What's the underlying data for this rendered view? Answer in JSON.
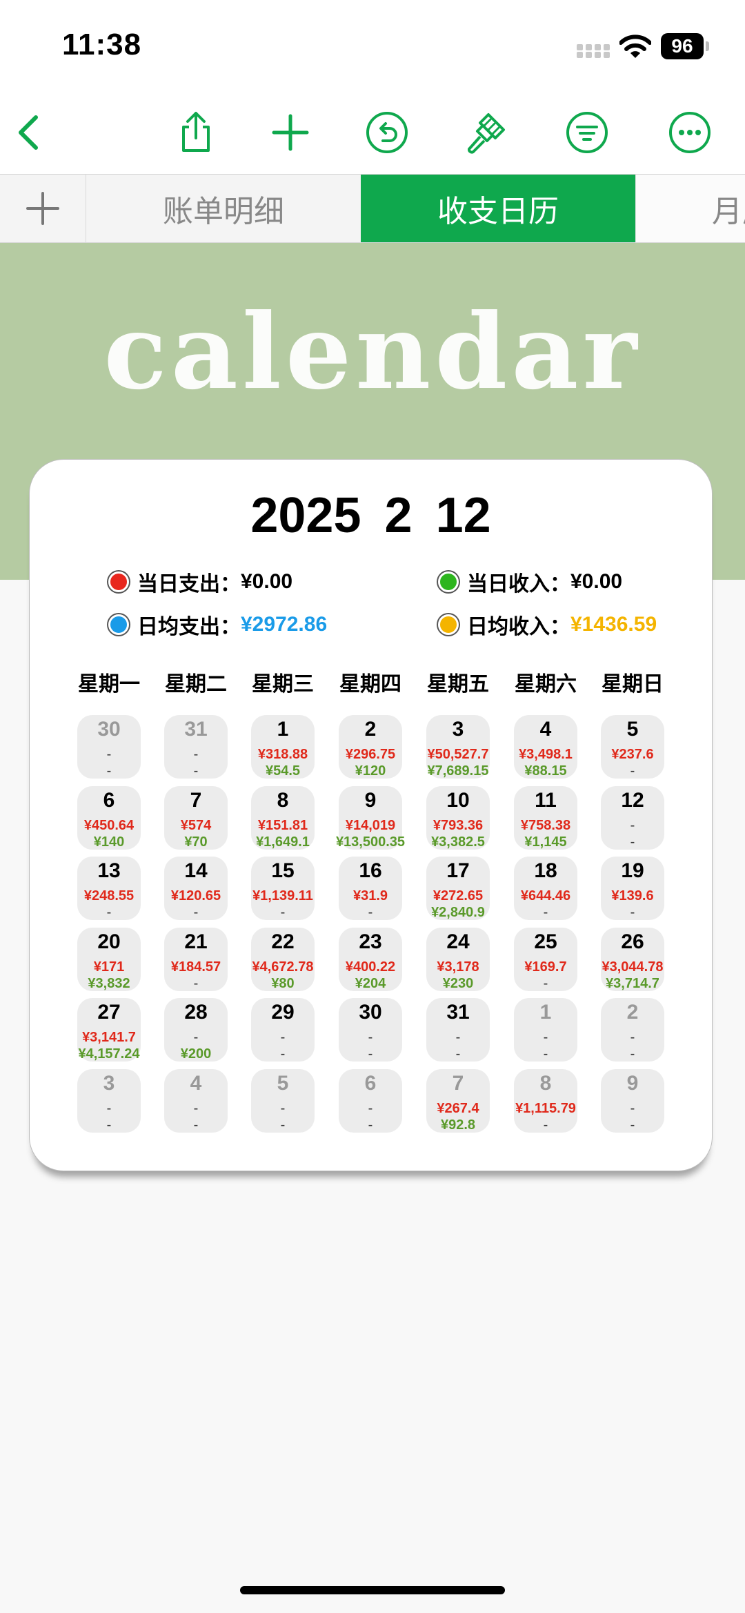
{
  "status": {
    "time": "11:38",
    "battery": "96"
  },
  "tabs": [
    {
      "label": "账单明细",
      "active": false
    },
    {
      "label": "收支日历",
      "active": true
    },
    {
      "label": "月度",
      "active": false
    }
  ],
  "banner": {
    "title": "calendar"
  },
  "card": {
    "date": "2025 2 12",
    "legend": {
      "today_expense_label": "当日支出：",
      "today_expense_value": "¥0.00",
      "today_income_label": "当日收入：",
      "today_income_value": "¥0.00",
      "avg_expense_label": "日均支出：",
      "avg_expense_value": "¥2972.86",
      "avg_income_label": "日均收入：",
      "avg_income_value": "¥1436.59"
    },
    "colors": {
      "expense": "#e0291b",
      "income": "#5a9a2a",
      "dot_red": "#e8271e",
      "dot_green": "#2db51e",
      "dot_blue": "#1a9be8",
      "dot_orange": "#f4b400"
    },
    "weekdays": [
      "星期一",
      "星期二",
      "星期三",
      "星期四",
      "星期五",
      "星期六",
      "星期日"
    ],
    "days": [
      {
        "n": "30",
        "e": "-",
        "i": "-",
        "out": true
      },
      {
        "n": "31",
        "e": "-",
        "i": "-",
        "out": true
      },
      {
        "n": "1",
        "e": "¥318.88",
        "i": "¥54.5"
      },
      {
        "n": "2",
        "e": "¥296.75",
        "i": "¥120"
      },
      {
        "n": "3",
        "e": "¥50,527.7",
        "i": "¥7,689.15"
      },
      {
        "n": "4",
        "e": "¥3,498.1",
        "i": "¥88.15"
      },
      {
        "n": "5",
        "e": "¥237.6",
        "i": "-"
      },
      {
        "n": "6",
        "e": "¥450.64",
        "i": "¥140"
      },
      {
        "n": "7",
        "e": "¥574",
        "i": "¥70"
      },
      {
        "n": "8",
        "e": "¥151.81",
        "i": "¥1,649.1"
      },
      {
        "n": "9",
        "e": "¥14,019",
        "i": "¥13,500.35"
      },
      {
        "n": "10",
        "e": "¥793.36",
        "i": "¥3,382.5"
      },
      {
        "n": "11",
        "e": "¥758.38",
        "i": "¥1,145"
      },
      {
        "n": "12",
        "e": "-",
        "i": "-"
      },
      {
        "n": "13",
        "e": "¥248.55",
        "i": "-"
      },
      {
        "n": "14",
        "e": "¥120.65",
        "i": "-"
      },
      {
        "n": "15",
        "e": "¥1,139.11",
        "i": "-"
      },
      {
        "n": "16",
        "e": "¥31.9",
        "i": "-"
      },
      {
        "n": "17",
        "e": "¥272.65",
        "i": "¥2,840.9"
      },
      {
        "n": "18",
        "e": "¥644.46",
        "i": "-"
      },
      {
        "n": "19",
        "e": "¥139.6",
        "i": "-"
      },
      {
        "n": "20",
        "e": "¥171",
        "i": "¥3,832"
      },
      {
        "n": "21",
        "e": "¥184.57",
        "i": "-"
      },
      {
        "n": "22",
        "e": "¥4,672.78",
        "i": "¥80"
      },
      {
        "n": "23",
        "e": "¥400.22",
        "i": "¥204"
      },
      {
        "n": "24",
        "e": "¥3,178",
        "i": "¥230"
      },
      {
        "n": "25",
        "e": "¥169.7",
        "i": "-"
      },
      {
        "n": "26",
        "e": "¥3,044.78",
        "i": "¥3,714.7"
      },
      {
        "n": "27",
        "e": "¥3,141.7",
        "i": "¥4,157.24"
      },
      {
        "n": "28",
        "e": "-",
        "i": "¥200"
      },
      {
        "n": "29",
        "e": "-",
        "i": "-"
      },
      {
        "n": "30",
        "e": "-",
        "i": "-"
      },
      {
        "n": "31",
        "e": "-",
        "i": "-"
      },
      {
        "n": "1",
        "e": "-",
        "i": "-",
        "out": true
      },
      {
        "n": "2",
        "e": "-",
        "i": "-",
        "out": true
      },
      {
        "n": "3",
        "e": "-",
        "i": "-",
        "out": true
      },
      {
        "n": "4",
        "e": "-",
        "i": "-",
        "out": true
      },
      {
        "n": "5",
        "e": "-",
        "i": "-",
        "out": true
      },
      {
        "n": "6",
        "e": "-",
        "i": "-",
        "out": true
      },
      {
        "n": "7",
        "e": "¥267.4",
        "i": "¥92.8",
        "out": true
      },
      {
        "n": "8",
        "e": "¥1,115.79",
        "i": "-",
        "out": true
      },
      {
        "n": "9",
        "e": "-",
        "i": "-",
        "out": true
      }
    ]
  }
}
